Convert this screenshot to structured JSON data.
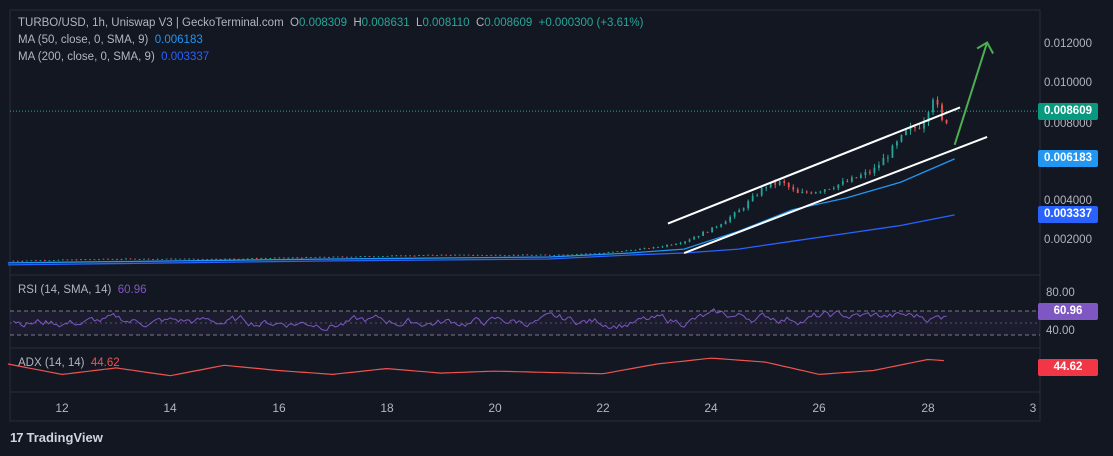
{
  "header": {
    "symbol": "TURBO/USD, 1h, Uniswap V3 | GeckoTerminal.com",
    "o_label": "O",
    "o_value": "0.008309",
    "h_label": "H",
    "h_value": "0.008631",
    "l_label": "L",
    "l_value": "0.008110",
    "c_label": "C",
    "c_value": "0.008609",
    "change": "+0.000300 (+3.61%)",
    "ma50_label": "MA (50, close, 0, SMA, 9)",
    "ma50_value": "0.006183",
    "ma200_label": "MA (200, close, 0, SMA, 9)",
    "ma200_value": "0.003337"
  },
  "price_axis": [
    "0.012000",
    "0.010000",
    "0.008000",
    "0.004000",
    "0.002000"
  ],
  "price_tags": {
    "last": "0.008609",
    "ma50": "0.006183",
    "ma200": "0.003337"
  },
  "rsi": {
    "label": "RSI (14, SMA, 14)",
    "value": "60.96",
    "axis": [
      "80.00",
      "40.00"
    ]
  },
  "adx": {
    "label": "ADX (14, 14)",
    "value": "44.62"
  },
  "x_axis": [
    "12",
    "14",
    "16",
    "18",
    "20",
    "22",
    "24",
    "26",
    "28",
    "3"
  ],
  "brand": "TradingView",
  "colors": {
    "up": "#26a69a",
    "down": "#ef5350",
    "ma50": "#2196f3",
    "ma200": "#2962ff",
    "rsi": "#7e57c2",
    "adx": "#ef5350",
    "arrow": "#4caf50"
  },
  "chart_data": [
    {
      "type": "candlestick",
      "title": "TURBO/USD, 1h, Uniswap V3",
      "ylim": [
        0.0003,
        0.0125
      ],
      "x_ticks": [
        "12",
        "14",
        "16",
        "18",
        "20",
        "22",
        "24",
        "26",
        "28",
        "3"
      ],
      "close_path": [
        [
          11,
          0.001
        ],
        [
          13,
          0.0011
        ],
        [
          15,
          0.0011
        ],
        [
          17,
          0.0012
        ],
        [
          19,
          0.0013
        ],
        [
          21,
          0.0013
        ],
        [
          22,
          0.0014
        ],
        [
          23,
          0.0017
        ],
        [
          23.5,
          0.002
        ],
        [
          24,
          0.0026
        ],
        [
          24.5,
          0.0035
        ],
        [
          25,
          0.0048
        ],
        [
          25.3,
          0.005
        ],
        [
          25.6,
          0.0044
        ],
        [
          26,
          0.0046
        ],
        [
          26.5,
          0.005
        ],
        [
          27,
          0.0056
        ],
        [
          27.3,
          0.0065
        ],
        [
          27.6,
          0.0075
        ],
        [
          27.9,
          0.008
        ],
        [
          28.1,
          0.0094
        ],
        [
          28.2,
          0.0086
        ],
        [
          28.3,
          0.00775
        ],
        [
          28.4,
          0.00861
        ]
      ],
      "last": {
        "open": 0.008309,
        "high": 0.008631,
        "low": 0.00811,
        "close": 0.008609
      },
      "series": [
        {
          "name": "MA (50, close, 0, SMA, 9)",
          "last": 0.006183,
          "points": [
            [
              11,
              0.0009
            ],
            [
              17,
              0.0011
            ],
            [
              21,
              0.0012
            ],
            [
              22.5,
              0.0014
            ],
            [
              23.5,
              0.0016
            ],
            [
              24.5,
              0.0025
            ],
            [
              25.5,
              0.0036
            ],
            [
              26.5,
              0.0042
            ],
            [
              27.5,
              0.005
            ],
            [
              28.5,
              0.006183
            ]
          ]
        },
        {
          "name": "MA (200, close, 0, SMA, 9)",
          "last": 0.003337,
          "points": [
            [
              11,
              0.0008
            ],
            [
              17,
              0.001
            ],
            [
              21,
              0.0011
            ],
            [
              22.5,
              0.0013
            ],
            [
              23.5,
              0.0014
            ],
            [
              24.5,
              0.0016
            ],
            [
              25.5,
              0.002
            ],
            [
              26.5,
              0.0024
            ],
            [
              27.5,
              0.0028
            ],
            [
              28.5,
              0.003337
            ]
          ]
        }
      ],
      "annotations": {
        "channel_upper": [
          [
            23.2,
            0.0029
          ],
          [
            28.6,
            0.0088
          ]
        ],
        "channel_lower": [
          [
            23.5,
            0.0014
          ],
          [
            29.1,
            0.0073
          ]
        ],
        "arrow": [
          [
            28.5,
            0.0069
          ],
          [
            29.1,
            0.0121
          ]
        ]
      }
    },
    {
      "type": "line",
      "title": "RSI (14, SMA, 14)",
      "ylim": [
        20,
        100
      ],
      "bands": [
        70,
        50,
        30
      ],
      "ticks": [
        "80.00",
        "40.00"
      ],
      "last": 60.96,
      "series": [
        {
          "name": "RSI (14, SMA, 14)",
          "last": 60.96
        }
      ]
    },
    {
      "type": "line",
      "title": "ADX (14, 14)",
      "last": 44.62,
      "series": [
        {
          "name": "ADX (14, 14)",
          "points": [
            [
              11,
              40
            ],
            [
              12,
              24
            ],
            [
              13,
              34
            ],
            [
              14,
              22
            ],
            [
              15,
              38
            ],
            [
              16,
              30
            ],
            [
              17,
              24
            ],
            [
              18,
              33
            ],
            [
              19,
              26
            ],
            [
              20,
              29
            ],
            [
              21,
              27
            ],
            [
              22,
              25
            ],
            [
              23,
              40
            ],
            [
              24,
              49
            ],
            [
              25,
              43
            ],
            [
              26,
              24
            ],
            [
              27,
              30
            ],
            [
              28,
              47
            ],
            [
              28.4,
              44.62
            ]
          ]
        }
      ]
    }
  ]
}
